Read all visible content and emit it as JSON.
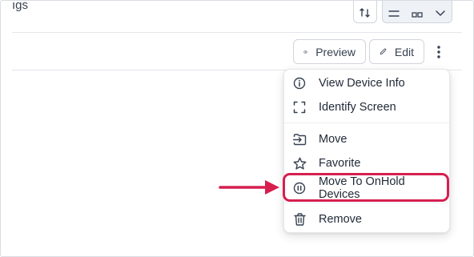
{
  "header": {
    "truncated_text": "ıgs"
  },
  "actions": {
    "preview_label": "Preview",
    "edit_label": "Edit"
  },
  "menu": {
    "items": [
      {
        "label": "View Device Info",
        "icon": "info-circle-icon"
      },
      {
        "label": "Identify Screen",
        "icon": "focus-frame-icon"
      },
      {
        "label": "Move",
        "icon": "move-into-icon"
      },
      {
        "label": "Favorite",
        "icon": "star-icon"
      },
      {
        "label": "Move To OnHold Devices",
        "icon": "pause-circle-icon"
      },
      {
        "label": "Remove",
        "icon": "trash-icon"
      }
    ]
  },
  "colors": {
    "highlight": "#d61f4f",
    "text": "#1f2937",
    "border": "#d1d5db"
  }
}
